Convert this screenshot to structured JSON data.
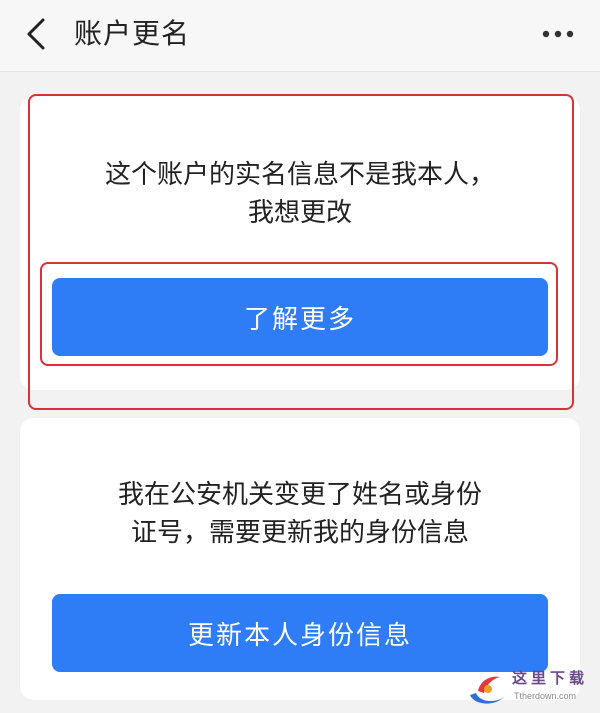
{
  "header": {
    "title": "账户更名",
    "back_icon": "chevron-left-icon",
    "more_icon": "more-horizontal-icon"
  },
  "cards": [
    {
      "text_lines": [
        "这个账户的实名信息不是我本人，",
        "我想更改"
      ],
      "button_label": "了解更多"
    },
    {
      "text_lines": [
        "我在公安机关变更了姓名或身份",
        "证号，需要更新我的身份信息"
      ],
      "button_label": "更新本人身份信息"
    }
  ],
  "watermark": {
    "text": "这里下载",
    "url": "Ttherdown.com"
  },
  "colors": {
    "primary": "#2e7cf6",
    "highlight": "#d9303a",
    "background": "#f2f2f2"
  }
}
